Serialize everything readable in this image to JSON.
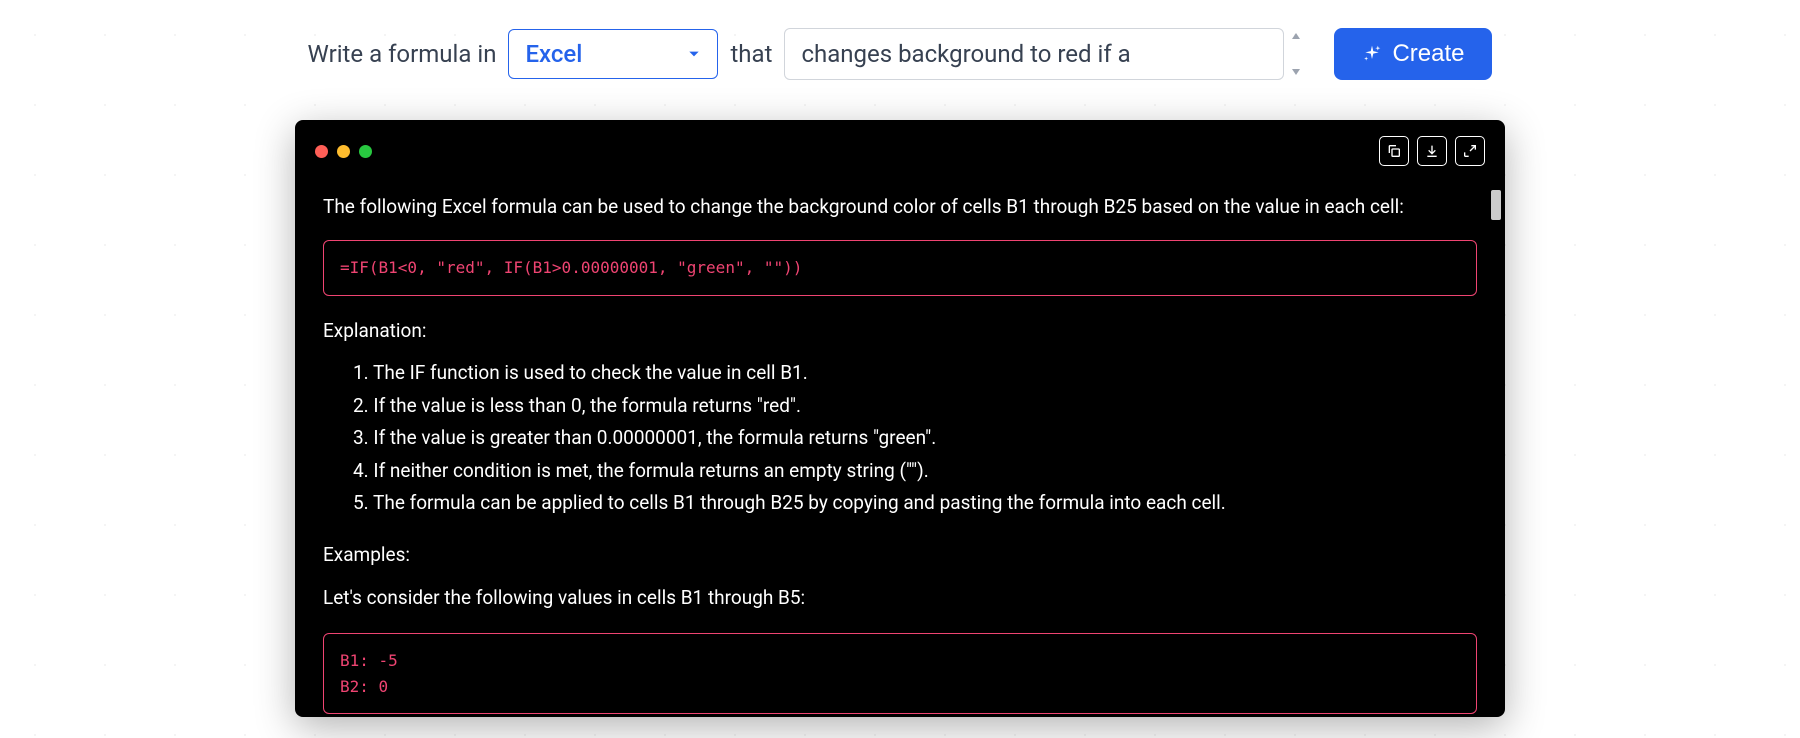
{
  "topbar": {
    "prompt_prefix": "Write a formula in",
    "dropdown_value": "Excel",
    "prompt_middle": "that",
    "input_value": "changes background to red if a",
    "create_label": "Create"
  },
  "terminal": {
    "intro": "The following Excel formula can be used to change the background color of cells B1 through B25 based on the value in each cell:",
    "formula": "=IF(B1<0, \"red\", IF(B1>0.00000001, \"green\", \"\"))",
    "explanation_title": "Explanation:",
    "explanation_items": [
      "1. The IF function is used to check the value in cell B1.",
      "2. If the value is less than 0, the formula returns \"red\".",
      "3. If the value is greater than 0.00000001, the formula returns \"green\".",
      "4. If neither condition is met, the formula returns an empty string (\"\").",
      "5. The formula can be applied to cells B1 through B25 by copying and pasting the formula into each cell."
    ],
    "examples_title": "Examples:",
    "examples_intro": "Let's consider the following values in cells B1 through B5:",
    "example_values": "B1: -5\nB2: 0"
  }
}
